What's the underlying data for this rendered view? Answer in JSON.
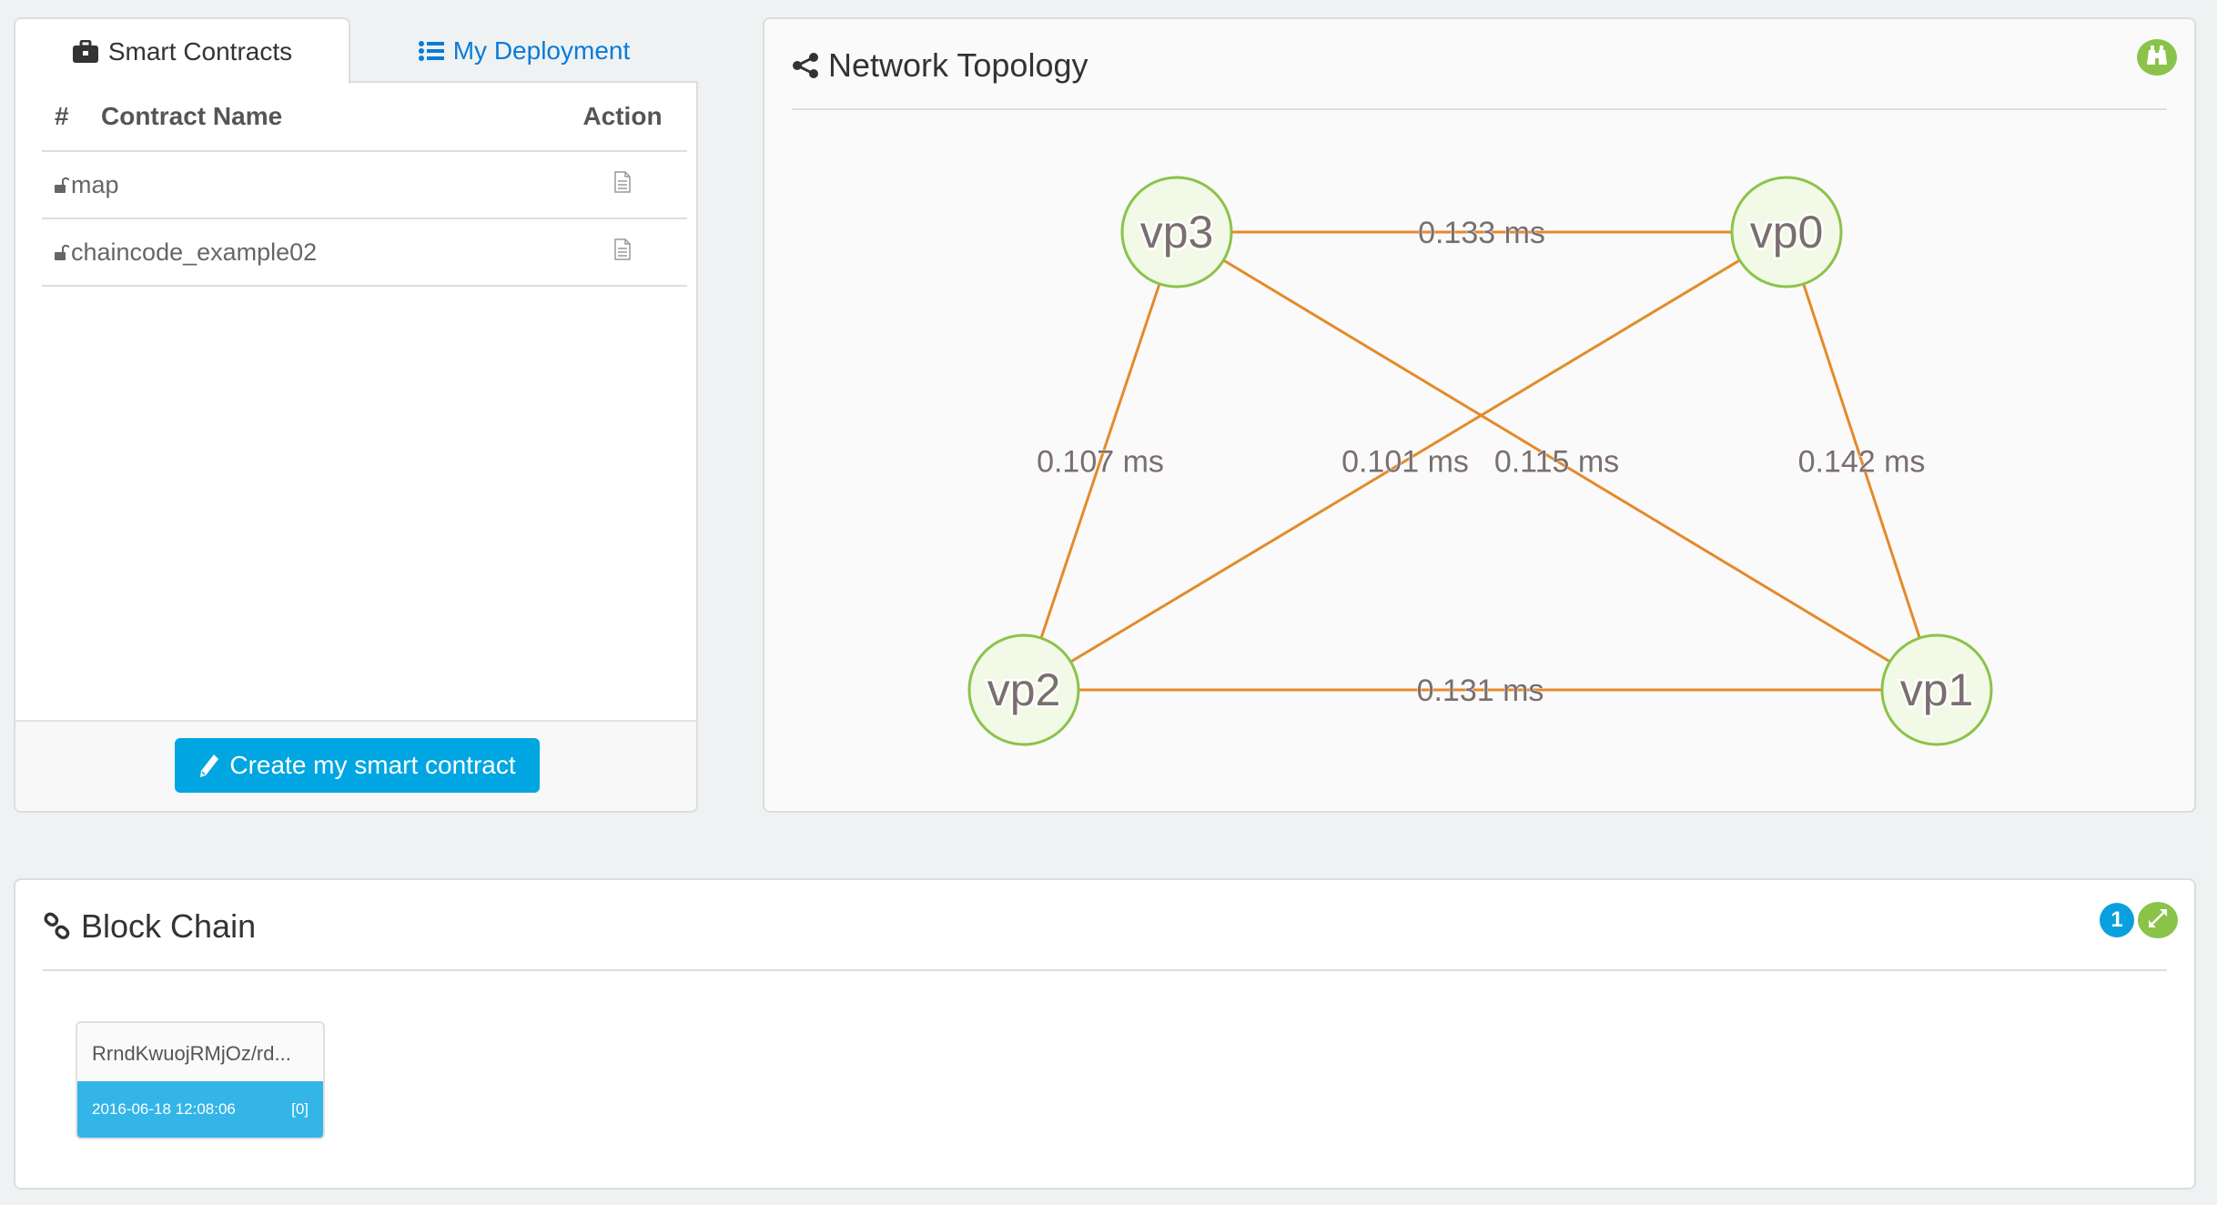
{
  "tabs": [
    {
      "label": "Smart Contracts",
      "icon": "briefcase-icon",
      "active": true
    },
    {
      "label": "My Deployment",
      "icon": "list-icon",
      "active": false
    }
  ],
  "contracts_table": {
    "columns": [
      "#",
      "Contract Name",
      "Action"
    ],
    "rows": [
      {
        "name": "map",
        "lock_icon": "unlock-icon",
        "action_icon": "document-icon"
      },
      {
        "name": "chaincode_example02",
        "lock_icon": "unlock-icon",
        "action_icon": "document-icon"
      }
    ]
  },
  "create_button": {
    "label": "Create my smart contract",
    "icon": "pencil-icon"
  },
  "topology": {
    "title": "Network Topology",
    "icon": "share-icon",
    "action_icon": "binoculars-icon",
    "colors": {
      "edge": "#e6892a",
      "node_fill": "#f2f9e7",
      "node_stroke": "#8bc34a",
      "label": "#7a6e6e"
    },
    "nodes": [
      {
        "id": "vp0",
        "label": "vp0"
      },
      {
        "id": "vp1",
        "label": "vp1"
      },
      {
        "id": "vp2",
        "label": "vp2"
      },
      {
        "id": "vp3",
        "label": "vp3"
      }
    ],
    "edges": [
      {
        "from": "vp3",
        "to": "vp0",
        "latency": "0.133 ms"
      },
      {
        "from": "vp3",
        "to": "vp2",
        "latency": "0.107 ms"
      },
      {
        "from": "vp0",
        "to": "vp2",
        "latency": "0.101 ms"
      },
      {
        "from": "vp3",
        "to": "vp1",
        "latency": "0.115 ms"
      },
      {
        "from": "vp0",
        "to": "vp1",
        "latency": "0.142 ms"
      },
      {
        "from": "vp2",
        "to": "vp1",
        "latency": "0.131 ms"
      }
    ]
  },
  "blockchain": {
    "title": "Block Chain",
    "icon": "chain-link-icon",
    "count_badge": "1",
    "expand_icon": "expand-icon",
    "blocks": [
      {
        "hash": "RrndKwuojRMjOz/rd...",
        "timestamp": "2016-06-18 12:08:06",
        "tx_count": "[0]"
      }
    ]
  }
}
